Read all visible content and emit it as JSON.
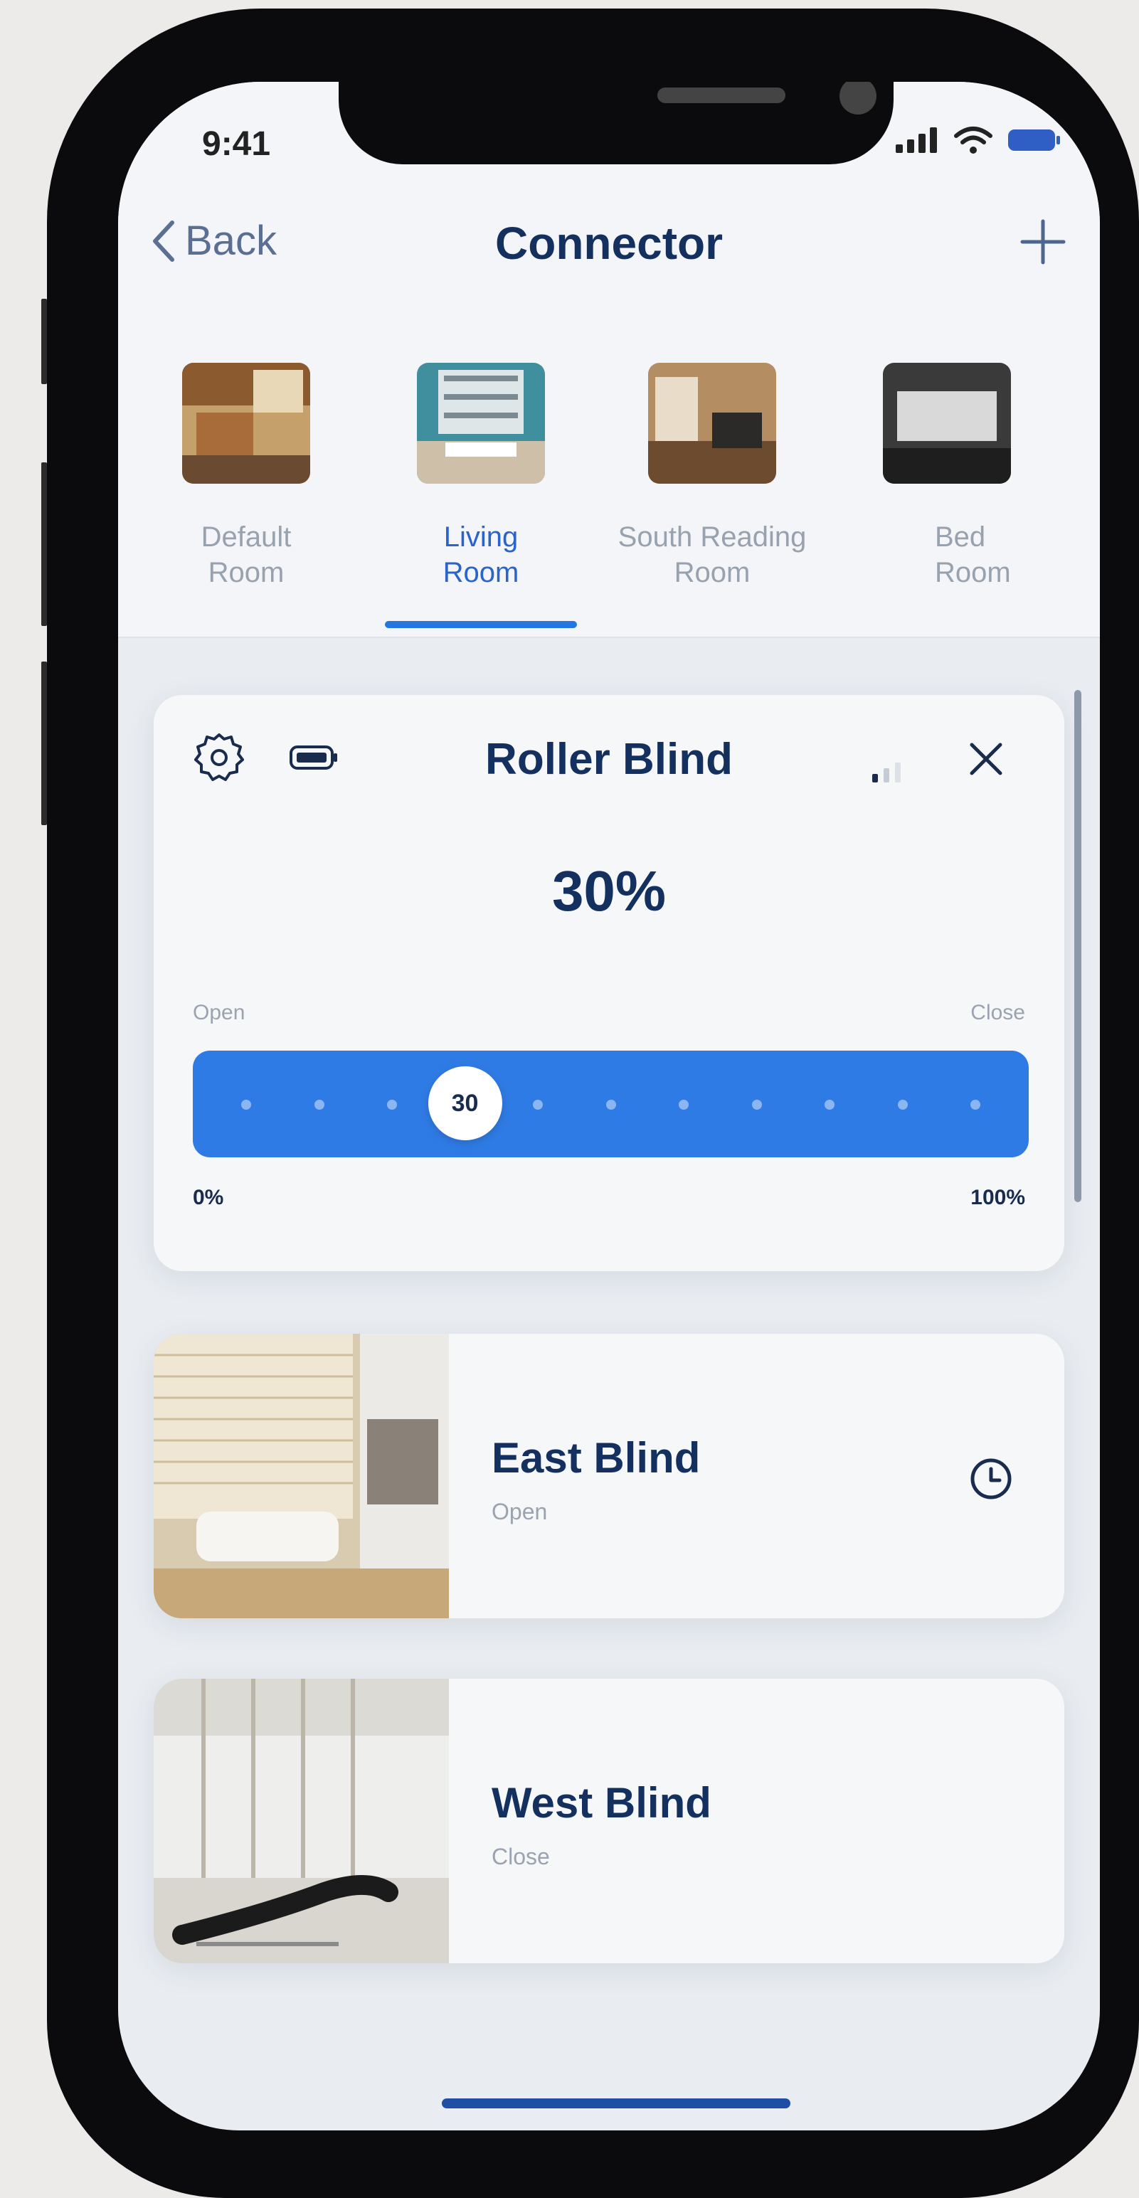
{
  "status": {
    "time": "9:41"
  },
  "nav": {
    "back_label": "Back",
    "title": "Connector"
  },
  "rooms": [
    {
      "label_line1": "Default",
      "label_line2": "Room",
      "active": false
    },
    {
      "label_line1": "Living",
      "label_line2": "Room",
      "active": true
    },
    {
      "label_line1": "South Reading",
      "label_line2": "Room",
      "active": false
    },
    {
      "label_line1": "Bed",
      "label_line2": "Room",
      "active": false
    }
  ],
  "roller": {
    "title": "Roller Blind",
    "percent_text": "30%",
    "position_value": 30,
    "slider_label": "30",
    "open_label": "Open",
    "close_label": "Close",
    "min_label": "0%",
    "max_label": "100%"
  },
  "blinds": [
    {
      "name": "East Blind",
      "state": "Open",
      "has_schedule": true
    },
    {
      "name": "West Blind",
      "state": "Close",
      "has_schedule": false
    }
  ],
  "colors": {
    "accent": "#2f7be5",
    "title": "#14305f",
    "muted": "#9aa3b0"
  }
}
